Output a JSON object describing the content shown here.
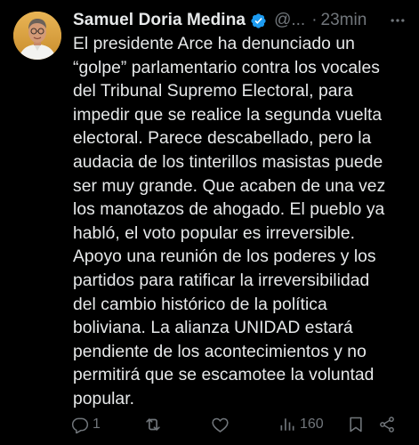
{
  "tweet": {
    "author": {
      "name": "Samuel Doria Medina",
      "handle": "@...",
      "verified": true,
      "avatar_icon": "profile-photo"
    },
    "separator": "·",
    "time": "23min",
    "text": "El presidente Arce ha denunciado un\n“golpe” parlamentario contra los vocales\ndel Tribunal Supremo Electoral, para\nimpedir que se realice la segunda vuelta\nelectoral. Parece descabellado, pero la\naudacia de los tinterillos masistas puede\nser muy grande. Que acaben de una vez\nlos manotazos de ahogado. El pueblo ya\nhabló, el voto popular es irreversible.\nApoyo una reunión de los poderes y los\npartidos para ratificar la irreversibilidad\ndel cambio histórico de la política\nboliviana. La alianza UNIDAD estará\npendiente de los acontecimientos y no\npermitirá que se escamotee la voluntad\npopular.",
    "actions": {
      "replies": "1",
      "retweets": "",
      "likes": "",
      "views": "160"
    }
  },
  "colors": {
    "background": "#000000",
    "text": "#e7e9ea",
    "muted": "#71767b",
    "verified": "#1d9bf0"
  }
}
